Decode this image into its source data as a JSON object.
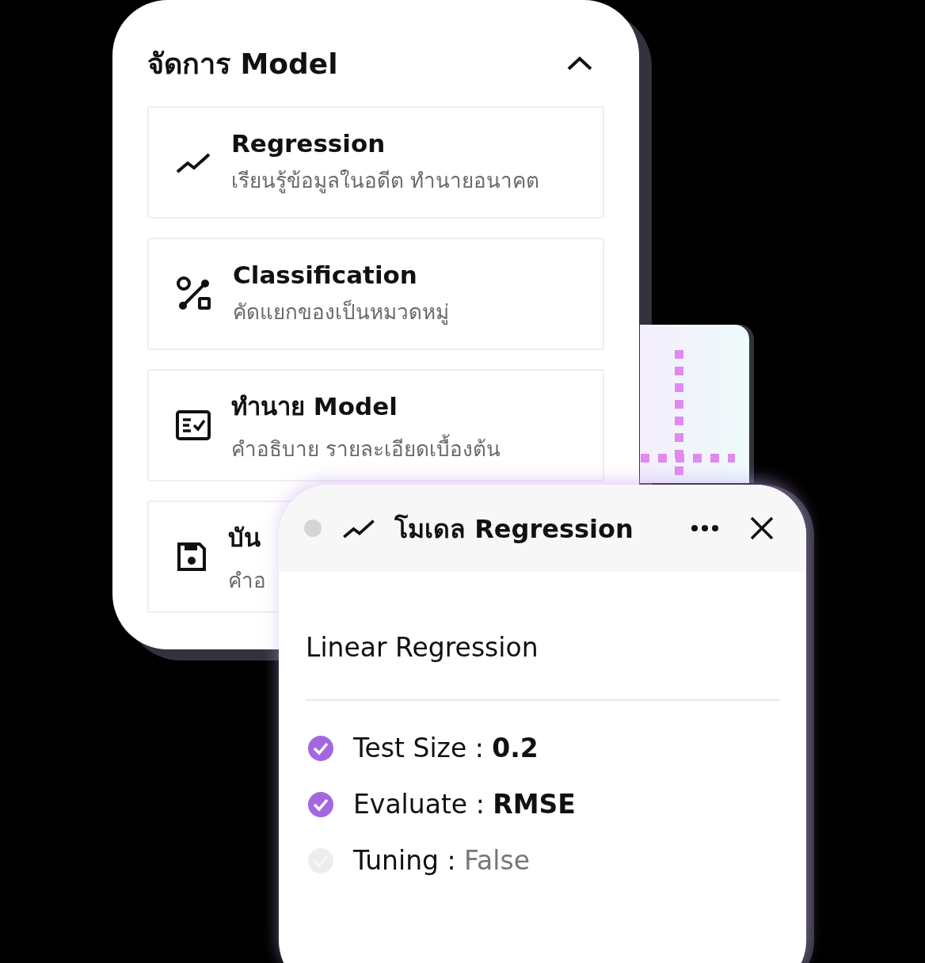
{
  "panel": {
    "title": "จัดการ Model",
    "expanded": true,
    "items": [
      {
        "kind": "trend",
        "title": "Regression",
        "subtitle": "เรียนรู้ข้อมูลในอดีต ทำนายอนาคต"
      },
      {
        "kind": "classify",
        "title": "Classification",
        "subtitle": "คัดแยกของเป็นหมวดหมู่"
      },
      {
        "kind": "checklist",
        "title": "ทำนาย Model",
        "subtitle": "คำอธิบาย รายละเอียดเบื้องต้น"
      },
      {
        "kind": "save",
        "title": "บัน",
        "subtitle": "คำอ"
      }
    ]
  },
  "popup": {
    "title": "โมเดล Regression",
    "model": "Linear Regression",
    "settings": [
      {
        "label": "Test Size :",
        "value": "0.2",
        "checked": true
      },
      {
        "label": "Evaluate :",
        "value": "RMSE",
        "checked": true
      },
      {
        "label": "Tuning :",
        "value": "False",
        "checked": false
      }
    ]
  }
}
